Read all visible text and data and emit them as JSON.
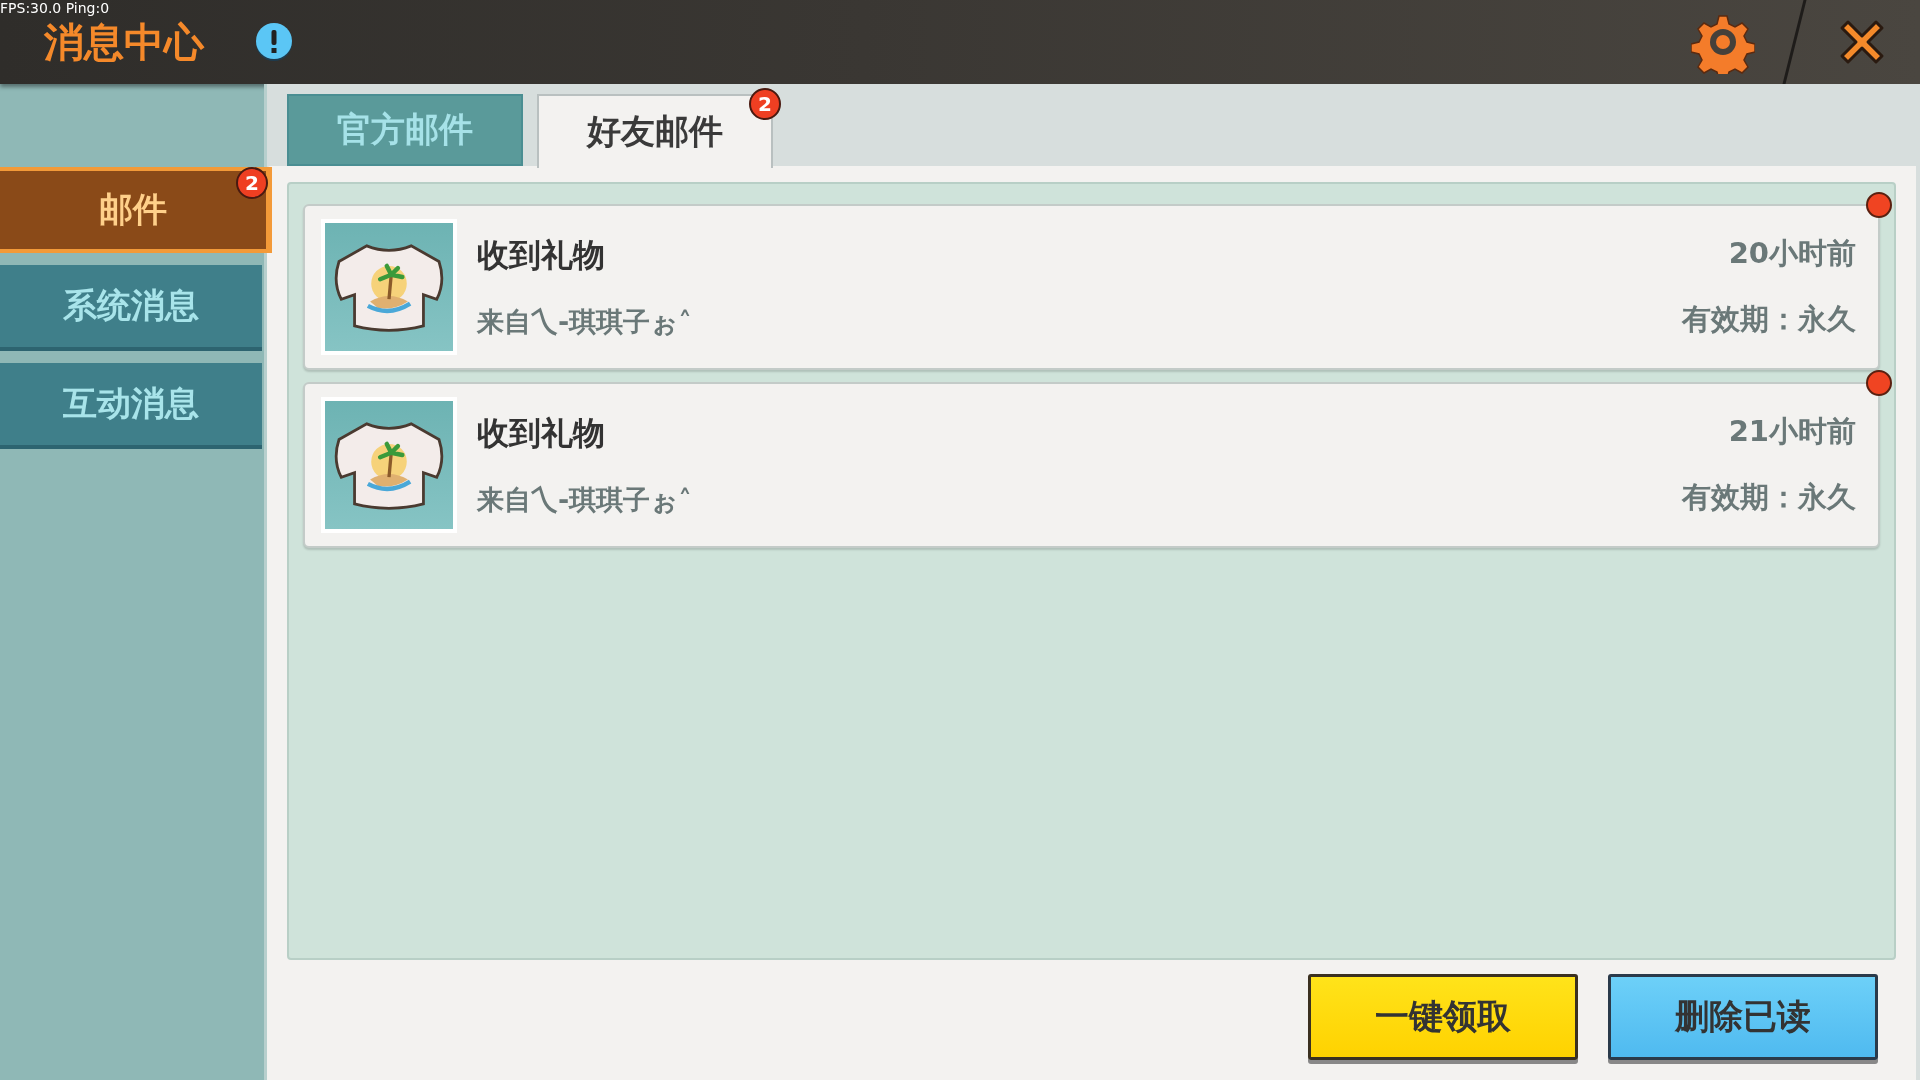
{
  "debug_overlay": "FPS:30.0  Ping:0",
  "header": {
    "title": "消息中心"
  },
  "sidebar": {
    "items": [
      {
        "label": "邮件",
        "selected": true,
        "badge": "2"
      },
      {
        "label": "系统消息",
        "selected": false
      },
      {
        "label": "互动消息",
        "selected": false
      }
    ]
  },
  "tabs": [
    {
      "label": "官方邮件",
      "selected": false
    },
    {
      "label": "好友邮件",
      "selected": true,
      "badge": "2"
    }
  ],
  "mails": [
    {
      "title": "收到礼物",
      "sender": "来自乀-琪琪子ぉ˄",
      "time": "20小时前",
      "expiry": "有效期：永久",
      "unread": true
    },
    {
      "title": "收到礼物",
      "sender": "来自乀-琪琪子ぉ˄",
      "time": "21小时前",
      "expiry": "有效期：永久",
      "unread": true
    }
  ],
  "buttons": [
    {
      "label": "一键领取",
      "kind": "primary"
    },
    {
      "label": "删除已读",
      "kind": "secondary"
    }
  ]
}
